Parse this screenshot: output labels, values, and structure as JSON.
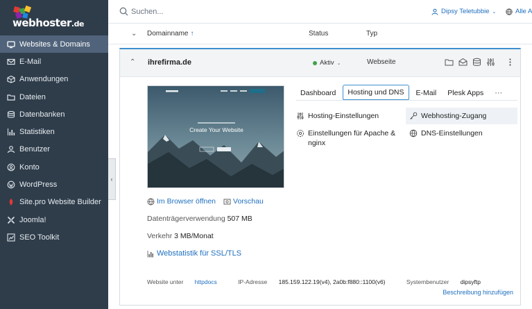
{
  "brand": {
    "logo_text": "webhoster",
    "logo_tld": ".de"
  },
  "sidebar": {
    "items": [
      {
        "label": "Websites & Domains",
        "icon": "monitor-icon",
        "active": true
      },
      {
        "label": "E-Mail",
        "icon": "mail-icon"
      },
      {
        "label": "Anwendungen",
        "icon": "box-icon"
      },
      {
        "label": "Dateien",
        "icon": "folder-icon"
      },
      {
        "label": "Datenbanken",
        "icon": "database-icon"
      },
      {
        "label": "Statistiken",
        "icon": "bar-chart-icon"
      },
      {
        "label": "Benutzer",
        "icon": "user-icon"
      },
      {
        "label": "Konto",
        "icon": "account-icon"
      },
      {
        "label": "WordPress",
        "icon": "wordpress-icon"
      },
      {
        "label": "Site.pro Website Builder",
        "icon": "sitepro-icon"
      },
      {
        "label": "Joomla!",
        "icon": "joomla-icon"
      },
      {
        "label": "SEO Toolkit",
        "icon": "seo-icon"
      }
    ]
  },
  "search": {
    "placeholder": "Suchen..."
  },
  "header": {
    "user": "Dipsy Teletubbie",
    "lang": "Alle Ab"
  },
  "table": {
    "col_domain": "Domainname",
    "col_status": "Status",
    "col_type": "Typ"
  },
  "domain": {
    "name": "ihrefirma.de",
    "status": "Aktiv",
    "type": "Webseite",
    "preview_title": "Create Your Website",
    "open_browser": "Im Browser öffnen",
    "preview_link": "Vorschau",
    "disk_label": "Datenträgerverwendung",
    "disk_value": "507 MB",
    "traffic_label": "Verkehr",
    "traffic_value": "3 MB/Monat",
    "stats_link": "Webstatistik für SSL/TLS",
    "tabs": [
      "Dashboard",
      "Hosting und DNS",
      "E-Mail",
      "Plesk Apps"
    ],
    "more": "···",
    "options": {
      "hosting": "Hosting-Einstellungen",
      "webhosting_access": "Webhosting-Zugang",
      "apache_line1": "Einstellungen für Apache &",
      "apache_line2": "nginx",
      "dns": "DNS-Einstellungen"
    },
    "footer": {
      "site_label": "Website unter",
      "site_value": "httpdocs",
      "ip_label": "IP-Adresse",
      "ip_value": "185.159.122.19(v4), 2a0b:f880::1100(v6)",
      "sysuser_label": "Systembenutzer",
      "sysuser_value": "dipsyftp"
    },
    "description_link": "Beschreibung hinzufügen"
  },
  "colors": {
    "sidebar": "#2f3d4b",
    "sidebar_active": "#50637a",
    "accent": "#1f6fbf",
    "status_ok": "#43a047"
  }
}
